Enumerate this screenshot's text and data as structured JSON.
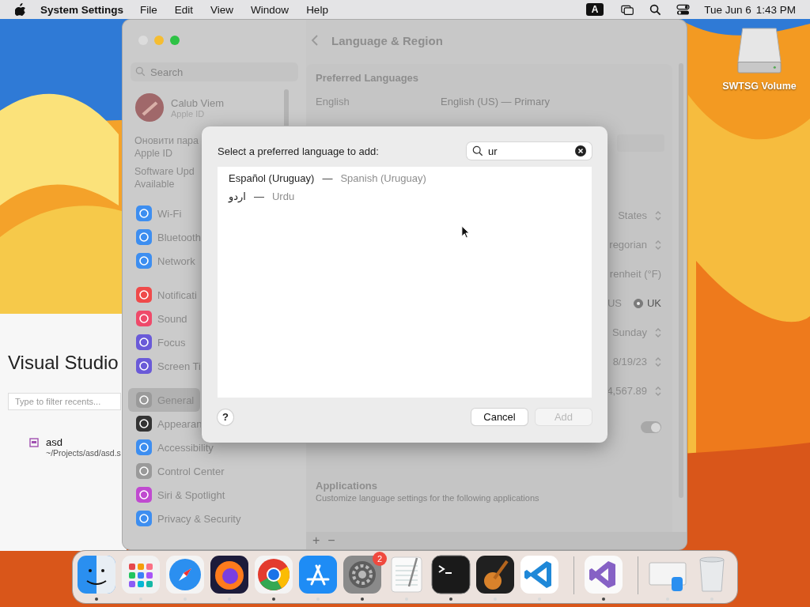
{
  "menubar": {
    "app": "System Settings",
    "menus": [
      "File",
      "Edit",
      "View",
      "Window",
      "Help"
    ],
    "input_source": "A",
    "date": "Tue Jun 6",
    "time": "1:43 PM"
  },
  "desktop_items": [
    {
      "label": "SWTSG Volume"
    }
  ],
  "vs_window": {
    "title": "Visual Studio",
    "filter": {
      "placeholder": "Type to filter recents..."
    },
    "recents": [
      {
        "name": "asd",
        "path": "~/Projects/asd/asd.s"
      }
    ]
  },
  "settings": {
    "search": {
      "placeholder": "Search"
    },
    "account": {
      "name": "Calub Viem",
      "subtitle": "Apple ID"
    },
    "notices": [
      {
        "lines": [
          "Оновити пара",
          "Apple ID"
        ]
      },
      {
        "lines": [
          "Software Upd",
          "Available"
        ]
      }
    ],
    "sidebar_groups": [
      {
        "items": [
          {
            "label": "Wi-Fi",
            "color": "#3d8ef0",
            "selected": false
          },
          {
            "label": "Bluetooth",
            "color": "#3d8ef0",
            "selected": false
          },
          {
            "label": "Network",
            "color": "#3d8ef0",
            "selected": false
          }
        ]
      },
      {
        "items": [
          {
            "label": "Notificati",
            "color": "#ef4a4a",
            "selected": false
          },
          {
            "label": "Sound",
            "color": "#ef4a6a",
            "selected": false
          },
          {
            "label": "Focus",
            "color": "#6a5ad8",
            "selected": false
          },
          {
            "label": "Screen Ti",
            "color": "#6a5ad8",
            "selected": false
          }
        ]
      },
      {
        "items": [
          {
            "label": "General",
            "color": "#9a9a9a",
            "selected": true
          },
          {
            "label": "Appearan",
            "color": "#333333",
            "selected": false
          },
          {
            "label": "Accessibility",
            "color": "#3d8ef0",
            "selected": false
          },
          {
            "label": "Control Center",
            "color": "#9a9a9a",
            "selected": false
          },
          {
            "label": "Siri & Spotlight",
            "color": "#c04ad0",
            "selected": false
          },
          {
            "label": "Privacy & Security",
            "color": "#3d8ef0",
            "selected": false
          }
        ]
      }
    ],
    "title": "Language & Region",
    "preferred_languages": {
      "heading": "Preferred Languages",
      "rows": [
        {
          "name": "English",
          "detail": "English (US) — Primary"
        }
      ]
    },
    "rows": [
      {
        "kind": "popup",
        "value": "States"
      },
      {
        "kind": "popup",
        "value": "regorian"
      },
      {
        "kind": "text",
        "value": "renheit (°F)"
      },
      {
        "kind": "radio",
        "options": [
          {
            "label": "US",
            "selected": false
          },
          {
            "label": "UK",
            "selected": true
          }
        ]
      },
      {
        "kind": "popup",
        "value": "Sunday"
      },
      {
        "kind": "popup",
        "value": "8/19/23"
      },
      {
        "kind": "popup",
        "value": "4,567.89"
      },
      {
        "kind": "toggle",
        "on": true
      }
    ],
    "applications": {
      "heading": "Applications",
      "description": "Customize language settings for the following applications"
    },
    "list_buttons": [
      "+",
      "−"
    ]
  },
  "dialog": {
    "prompt": "Select a preferred language to add:",
    "search": {
      "value": "ur"
    },
    "results": [
      {
        "native": "Español (Uruguay)",
        "separator": "—",
        "english": "Spanish (Uruguay)",
        "selected": false
      },
      {
        "native": "اردو",
        "separator": "—",
        "english": "Urdu",
        "selected": false
      }
    ],
    "help": "?",
    "buttons": [
      {
        "label": "Cancel",
        "disabled": false
      },
      {
        "label": "Add",
        "disabled": true
      }
    ]
  },
  "dock": [
    {
      "kind": "finder",
      "running": true
    },
    {
      "kind": "launchpad",
      "running": false
    },
    {
      "kind": "safari",
      "running": false
    },
    {
      "kind": "firefox",
      "running": false
    },
    {
      "kind": "chrome",
      "running": true
    },
    {
      "kind": "appstore",
      "running": false
    },
    {
      "kind": "settings",
      "running": true,
      "badge": "2"
    },
    {
      "kind": "textedit",
      "running": false
    },
    {
      "kind": "terminal",
      "running": true
    },
    {
      "kind": "garageband",
      "running": false
    },
    {
      "kind": "vscode",
      "running": false
    },
    {
      "kind": "separator"
    },
    {
      "kind": "visualstudio",
      "running": true
    },
    {
      "kind": "separator"
    },
    {
      "kind": "downloads",
      "running": false
    },
    {
      "kind": "trash",
      "running": false
    }
  ]
}
